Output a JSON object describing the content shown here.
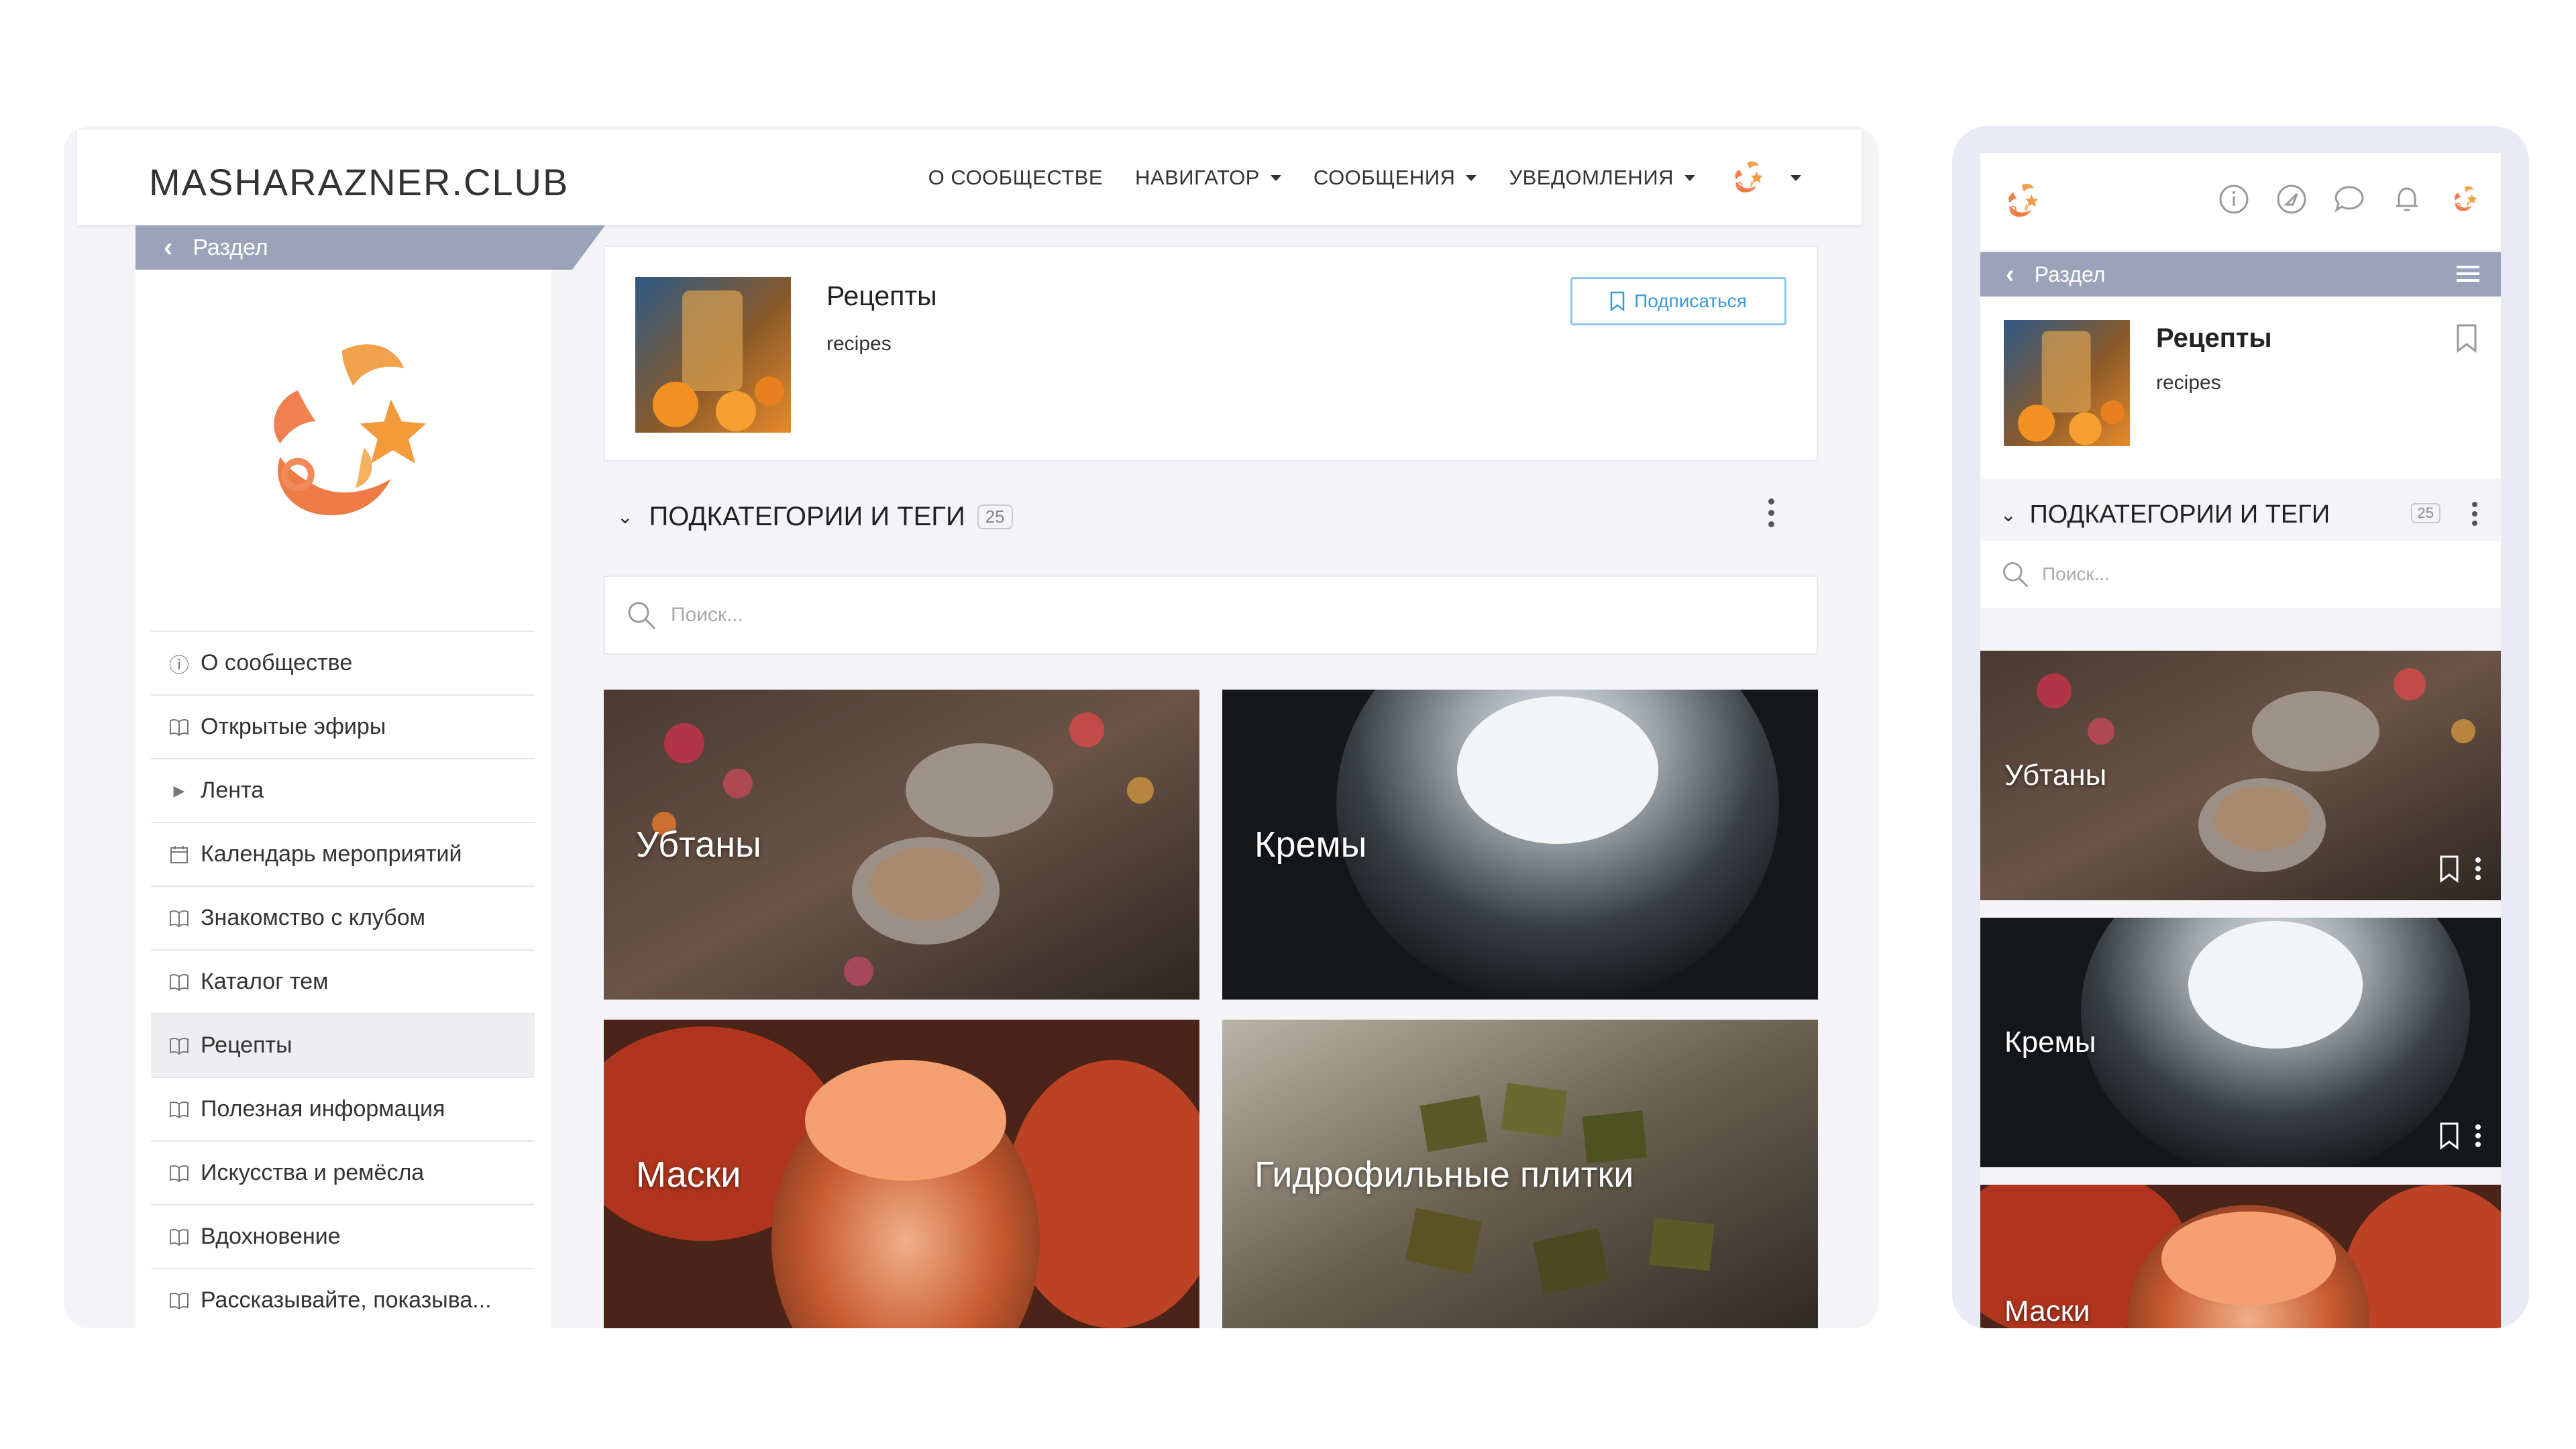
{
  "brand": "MASHARAZNER.CLUB",
  "nav": {
    "about": "О СООБЩЕСТВЕ",
    "navigator": "НАВИГАТОР",
    "messages": "СООБЩЕНИЯ",
    "notifications": "УВЕДОМЛЕНИЯ"
  },
  "section_label": "Раздел",
  "sidebar": {
    "items": [
      {
        "label": "О сообществе",
        "icon": "info-icon"
      },
      {
        "label": "Открытые эфиры",
        "icon": "book-icon"
      },
      {
        "label": "Лента",
        "icon": "caret-right-icon"
      },
      {
        "label": "Календарь мероприятий",
        "icon": "calendar-icon"
      },
      {
        "label": "Знакомство с клубом",
        "icon": "book-icon"
      },
      {
        "label": "Каталог тем",
        "icon": "book-icon"
      },
      {
        "label": "Рецепты",
        "icon": "book-icon",
        "active": true
      },
      {
        "label": "Полезная информация",
        "icon": "book-icon"
      },
      {
        "label": "Искусства и ремёсла",
        "icon": "book-icon"
      },
      {
        "label": "Вдохновение",
        "icon": "book-icon"
      },
      {
        "label": "Рассказывайте, показыва...",
        "icon": "book-icon"
      }
    ]
  },
  "category": {
    "title": "Рецепты",
    "slug": "recipes",
    "subscribe_label": "Подписаться"
  },
  "subcategories": {
    "heading": "ПОДКАТЕГОРИИ И ТЕГИ",
    "count": "25",
    "search_placeholder": "Поиск...",
    "tiles": [
      "Убтаны",
      "Кремы",
      "Маски",
      "Гидрофильные плитки"
    ]
  },
  "mobile": {
    "section_label": "Раздел",
    "title": "Рецепты",
    "slug": "recipes",
    "heading": "ПОДКАТЕГОРИИ И ТЕГИ",
    "count": "25",
    "search_placeholder": "Поиск...",
    "tiles": [
      "Убтаны",
      "Кремы",
      "Маски"
    ]
  },
  "colors": {
    "accent": "#3d9ad8",
    "section_bar": "#9aa3b9",
    "brand_orange": "#f08a3a"
  }
}
